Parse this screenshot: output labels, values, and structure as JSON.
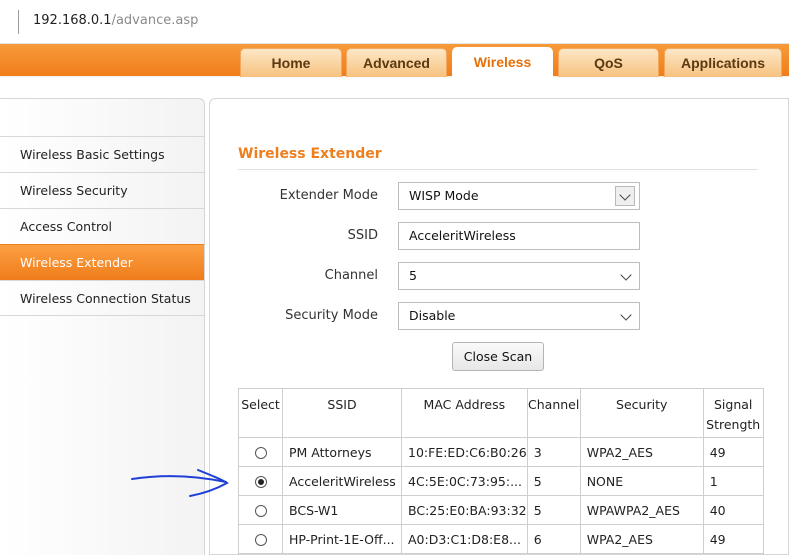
{
  "browser": {
    "url_host": "192.168.0.1",
    "url_path": "/advance.asp"
  },
  "tabs": [
    {
      "label": "Home",
      "active": false
    },
    {
      "label": "Advanced",
      "active": false
    },
    {
      "label": "Wireless",
      "active": true
    },
    {
      "label": "QoS",
      "active": false
    },
    {
      "label": "Applications",
      "active": false
    }
  ],
  "sidebar": {
    "items": [
      {
        "label": "Wireless Basic Settings",
        "active": false
      },
      {
        "label": "Wireless Security",
        "active": false
      },
      {
        "label": "Access Control",
        "active": false
      },
      {
        "label": "Wireless Extender",
        "active": true
      },
      {
        "label": "Wireless Connection Status",
        "active": false
      }
    ]
  },
  "main": {
    "title": "Wireless Extender",
    "extender_mode": {
      "label": "Extender Mode",
      "value": "WISP Mode"
    },
    "ssid": {
      "label": "SSID",
      "value": "AcceleritWireless"
    },
    "channel": {
      "label": "Channel",
      "value": "5"
    },
    "security_mode": {
      "label": "Security Mode",
      "value": "Disable"
    },
    "close_scan_label": "Close Scan",
    "table": {
      "headers": [
        "Select",
        "SSID",
        "MAC Address",
        "Channel",
        "Security",
        "Signal Strength"
      ],
      "rows": [
        {
          "selected": false,
          "ssid": "PM Attorneys",
          "mac": "10:FE:ED:C6:B0:26",
          "channel": "3",
          "security": "WPA2_AES",
          "signal": "49"
        },
        {
          "selected": true,
          "ssid": "AcceleritWireless",
          "mac": "4C:5E:0C:73:95:...",
          "channel": "5",
          "security": "NONE",
          "signal": "1"
        },
        {
          "selected": false,
          "ssid": "BCS-W1",
          "mac": "BC:25:E0:BA:93:32",
          "channel": "5",
          "security": "WPAWPA2_AES",
          "signal": "40"
        },
        {
          "selected": false,
          "ssid": "HP-Print-1E-Off...",
          "mac": "A0:D3:C1:D8:E8...",
          "channel": "6",
          "security": "WPA2_AES",
          "signal": "49"
        }
      ]
    }
  },
  "colors": {
    "accent": "#f07d1a",
    "title": "#ee7f1f",
    "annotation": "#1f3fd6"
  },
  "annotation": {
    "icon": "hand-drawn-arrow-icon"
  }
}
